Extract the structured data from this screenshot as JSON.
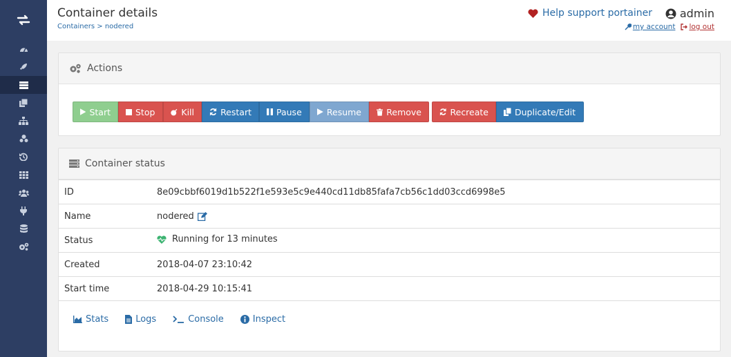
{
  "sidebar": {
    "items": [
      {
        "icon": "dashboard-icon"
      },
      {
        "icon": "rocket-icon"
      },
      {
        "icon": "containers-list-icon",
        "active": true
      },
      {
        "icon": "clone-icon"
      },
      {
        "icon": "sitemap-icon"
      },
      {
        "icon": "cubes-icon"
      },
      {
        "icon": "history-icon"
      },
      {
        "icon": "th-icon"
      },
      {
        "icon": "users-icon"
      },
      {
        "icon": "plug-icon"
      },
      {
        "icon": "database-icon"
      },
      {
        "icon": "cogs-icon"
      }
    ]
  },
  "header": {
    "title": "Container details",
    "breadcrumb_link": "Containers",
    "breadcrumb_sep": " > ",
    "breadcrumb_current": "nodered",
    "support": "Help support portainer",
    "username": "admin",
    "my_account": "my account",
    "log_out": "log out"
  },
  "actions": {
    "title": "Actions",
    "start": "Start",
    "stop": "Stop",
    "kill": "Kill",
    "restart": "Restart",
    "pause": "Pause",
    "resume": "Resume",
    "remove": "Remove",
    "recreate": "Recreate",
    "duplicate": "Duplicate/Edit"
  },
  "status": {
    "title": "Container status",
    "rows": [
      {
        "label": "ID",
        "value": "8e09cbbf6019d1b522f1e593e5c9e440cd11db85fafa7cb56c1dd03ccd6998e5"
      },
      {
        "label": "Name",
        "value": "nodered"
      },
      {
        "label": "Status",
        "value": "Running for 13 minutes"
      },
      {
        "label": "Created",
        "value": "2018-04-07 23:10:42"
      },
      {
        "label": "Start time",
        "value": "2018-04-29 10:15:41"
      }
    ],
    "links": {
      "stats": "Stats",
      "logs": "Logs",
      "console": "Console",
      "inspect": "Inspect"
    }
  },
  "colors": {
    "sidebar": "#2d3e63",
    "primary": "#337ab7",
    "danger": "#d9534f",
    "success": "#8fce8f",
    "link": "#2a6ba6",
    "heartbeat": "#3cb371"
  }
}
